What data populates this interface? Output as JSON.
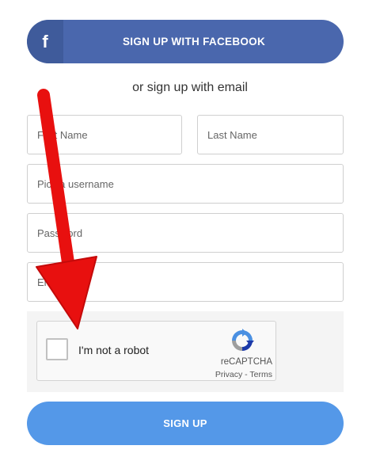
{
  "facebook_button": {
    "icon": "f",
    "label": "SIGN UP WITH FACEBOOK"
  },
  "divider_text": "or sign up with email",
  "form": {
    "first_name_placeholder": "First Name",
    "last_name_placeholder": "Last Name",
    "username_placeholder": "Pick a username",
    "password_placeholder": "Password",
    "email_placeholder": "Email"
  },
  "captcha": {
    "label": "I'm not a robot",
    "brand": "reCAPTCHA",
    "privacy": "Privacy",
    "separator": " - ",
    "terms": "Terms"
  },
  "signup_button": {
    "label": "SIGN UP"
  },
  "colors": {
    "facebook": "#4a67ad",
    "signup": "#5498e8",
    "arrow": "#e8100f"
  }
}
